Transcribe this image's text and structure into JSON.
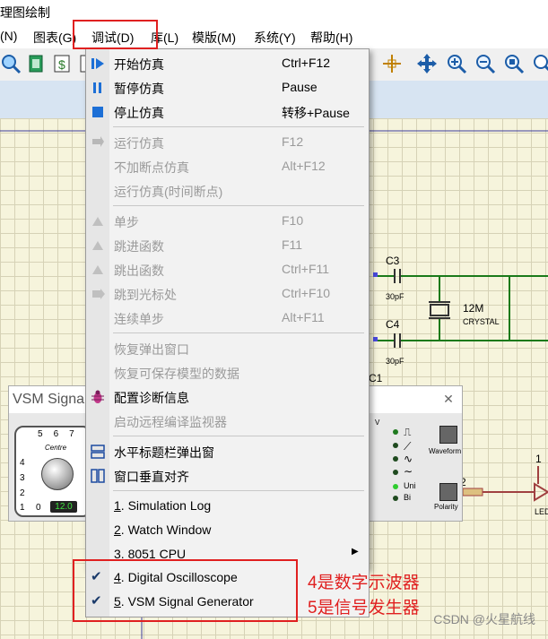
{
  "window": {
    "title": "理图绘制"
  },
  "menubar": [
    {
      "label": "(N)"
    },
    {
      "label": "图表(G)"
    },
    {
      "label": "调试(D)"
    },
    {
      "label": "库(L)"
    },
    {
      "label": "模版(M)"
    },
    {
      "label": "系统(Y)"
    },
    {
      "label": "帮助(H)"
    }
  ],
  "debug_menu": {
    "items": [
      {
        "label": "开始仿真",
        "shortcut": "Ctrl+F12"
      },
      {
        "label": "暂停仿真",
        "shortcut": "Pause"
      },
      {
        "label": "停止仿真",
        "shortcut": "转移+Pause"
      },
      {
        "label": "运行仿真",
        "shortcut": "F12"
      },
      {
        "label": "不加断点仿真",
        "shortcut": "Alt+F12"
      },
      {
        "label": "运行仿真(时间断点)",
        "shortcut": ""
      },
      {
        "label": "单步",
        "shortcut": "F10"
      },
      {
        "label": "跳进函数",
        "shortcut": "F11"
      },
      {
        "label": "跳出函数",
        "shortcut": "Ctrl+F11"
      },
      {
        "label": "跳到光标处",
        "shortcut": "Ctrl+F10"
      },
      {
        "label": "连续单步",
        "shortcut": "Alt+F11"
      },
      {
        "label": "恢复弹出窗口",
        "shortcut": ""
      },
      {
        "label": "恢复可保存模型的数据",
        "shortcut": ""
      },
      {
        "label": "配置诊断信息",
        "shortcut": ""
      },
      {
        "label": "启动远程编译监视器",
        "shortcut": ""
      },
      {
        "label": "水平标题栏弹出窗",
        "shortcut": ""
      },
      {
        "label": "窗口垂直对齐",
        "shortcut": ""
      },
      {
        "num": "1",
        "label": ". Simulation Log"
      },
      {
        "num": "2",
        "label": ". Watch Window"
      },
      {
        "num": "3",
        "label": ". 8051 CPU"
      },
      {
        "num": "4",
        "label": ". Digital Oscilloscope"
      },
      {
        "num": "5",
        "label": ". VSM Signal Generator"
      }
    ]
  },
  "schematic": {
    "c3": "C3",
    "c3_val": "30pF",
    "c4": "C4",
    "c4_val": "30pF",
    "crystal": "12M",
    "crystal_type": "CRYSTAL",
    "c1": "C1",
    "pin2": "2",
    "pin1": "1",
    "led": "LED"
  },
  "vsm_window": {
    "title": "VSM Signal",
    "centre": "Centre",
    "dial_top": [
      "5",
      "6",
      "7"
    ],
    "dial_left": [
      "4",
      "3",
      "2",
      "1"
    ],
    "dial_bottom": "0",
    "value": "12.0",
    "v_label": "V",
    "waveform": "Waveform",
    "polarity": "Polarity",
    "uni": "Uni",
    "bi": "Bi"
  },
  "annotations": {
    "note4": "4是数字示波器",
    "note5": "5是信号发生器",
    "watermark": "CSDN @火星航线"
  },
  "colors": {
    "accent": "#e02020",
    "canvas_bg": "#f6f4dc",
    "wire": "#1a7a1a"
  }
}
